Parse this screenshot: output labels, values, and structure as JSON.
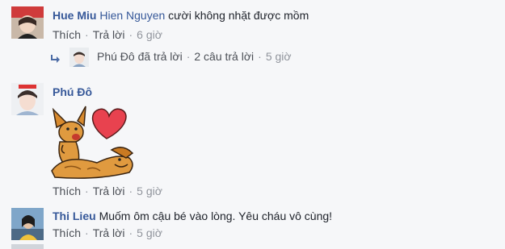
{
  "comments": [
    {
      "author": "Hue Miu",
      "tag": "Hien Nguyen",
      "text": "cười không nhặt được mồm",
      "actions": {
        "like": "Thích",
        "reply": "Trả lời",
        "time": "6 giờ"
      },
      "replies_summary": {
        "author": "Phú Đô",
        "verb": "đã trả lời",
        "count": "2 câu trả lời",
        "time": "5 giờ"
      }
    },
    {
      "author": "Phú Đô",
      "sticker": "dog-and-heart-sticker",
      "actions": {
        "like": "Thích",
        "reply": "Trả lời",
        "time": "5 giờ"
      }
    },
    {
      "author": "Thi Lieu",
      "text": "Muốm ôm cậu bé vào lòng. Yêu cháu vô cùng!",
      "actions": {
        "like": "Thích",
        "reply": "Trả lời",
        "time": "5 giờ"
      }
    }
  ],
  "separator": "·",
  "colors": {
    "author": "#365899",
    "meta": "#90949c",
    "link": "#4b4f56",
    "background": "#f6f7f9",
    "heart": "#e8424f",
    "dog": "#d88a2e"
  },
  "icons": {
    "reply_arrow": "reply-arrow-icon"
  }
}
